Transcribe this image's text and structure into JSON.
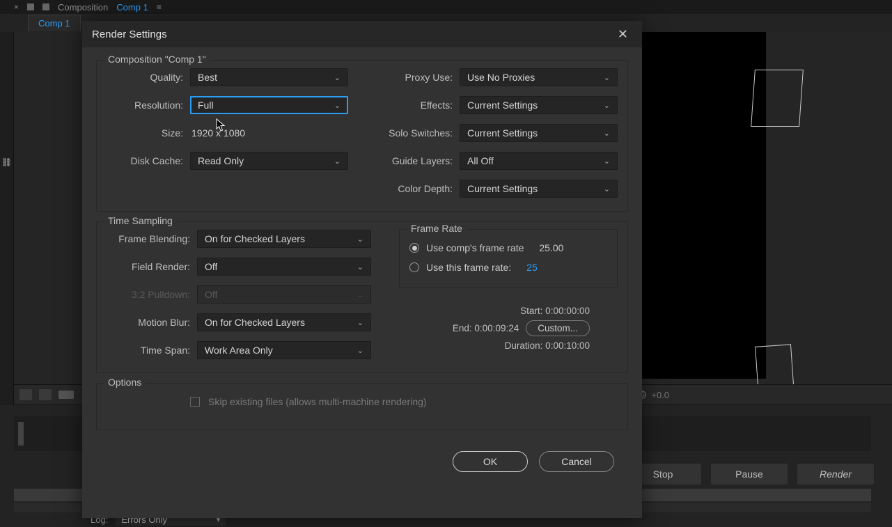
{
  "tab_strip": {
    "prefix": "Composition",
    "name": "Comp 1"
  },
  "sub_tab": "Comp 1",
  "footer_overlay": "+0.0",
  "queue": {
    "stop": "Stop",
    "pause": "Pause",
    "render": "Render"
  },
  "log": {
    "label": "Log:",
    "value": "Errors Only"
  },
  "dialog": {
    "title": "Render Settings",
    "comp_legend": "Composition \"Comp 1\"",
    "left1": {
      "quality_label": "Quality:",
      "quality_value": "Best",
      "resolution_label": "Resolution:",
      "resolution_value": "Full",
      "size_label": "Size:",
      "size_value": "1920 x 1080",
      "disk_cache_label": "Disk Cache:",
      "disk_cache_value": "Read Only"
    },
    "right1": {
      "proxy_label": "Proxy Use:",
      "proxy_value": "Use No Proxies",
      "effects_label": "Effects:",
      "effects_value": "Current Settings",
      "solo_label": "Solo Switches:",
      "solo_value": "Current Settings",
      "guide_label": "Guide Layers:",
      "guide_value": "All Off",
      "depth_label": "Color Depth:",
      "depth_value": "Current Settings"
    },
    "time_sampling_legend": "Time Sampling",
    "ts": {
      "fb_label": "Frame Blending:",
      "fb_value": "On for Checked Layers",
      "fr_label": "Field Render:",
      "fr_value": "Off",
      "pd_label": "3:2 Pulldown:",
      "pd_value": "Off",
      "mb_label": "Motion Blur:",
      "mb_value": "On for Checked Layers",
      "span_label": "Time Span:",
      "span_value": "Work Area Only"
    },
    "framerate": {
      "legend": "Frame Rate",
      "use_comp_label": "Use comp's frame rate",
      "use_comp_value": "25.00",
      "use_this_label": "Use this frame rate:",
      "use_this_value": "25"
    },
    "timing": {
      "start": "Start: 0:00:00:00",
      "end": "End: 0:00:09:24",
      "duration": "Duration: 0:00:10:00",
      "custom": "Custom..."
    },
    "options_legend": "Options",
    "skip_label": "Skip existing files (allows multi-machine rendering)",
    "ok": "OK",
    "cancel": "Cancel"
  }
}
